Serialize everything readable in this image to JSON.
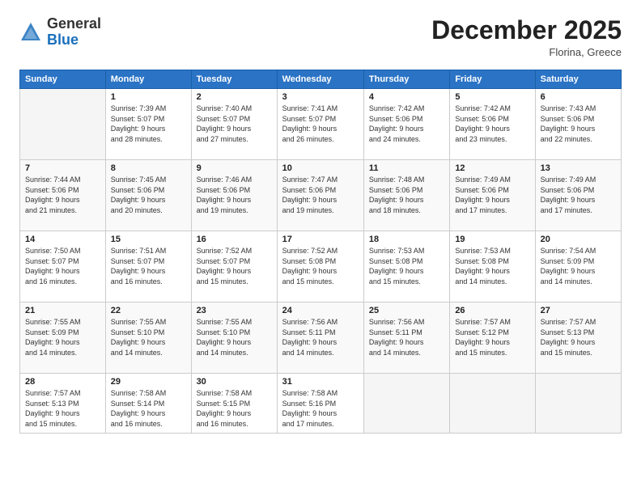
{
  "header": {
    "logo_general": "General",
    "logo_blue": "Blue",
    "month_year": "December 2025",
    "location": "Florina, Greece"
  },
  "days_of_week": [
    "Sunday",
    "Monday",
    "Tuesday",
    "Wednesday",
    "Thursday",
    "Friday",
    "Saturday"
  ],
  "weeks": [
    [
      {
        "num": "",
        "info": ""
      },
      {
        "num": "1",
        "info": "Sunrise: 7:39 AM\nSunset: 5:07 PM\nDaylight: 9 hours\nand 28 minutes."
      },
      {
        "num": "2",
        "info": "Sunrise: 7:40 AM\nSunset: 5:07 PM\nDaylight: 9 hours\nand 27 minutes."
      },
      {
        "num": "3",
        "info": "Sunrise: 7:41 AM\nSunset: 5:07 PM\nDaylight: 9 hours\nand 26 minutes."
      },
      {
        "num": "4",
        "info": "Sunrise: 7:42 AM\nSunset: 5:06 PM\nDaylight: 9 hours\nand 24 minutes."
      },
      {
        "num": "5",
        "info": "Sunrise: 7:42 AM\nSunset: 5:06 PM\nDaylight: 9 hours\nand 23 minutes."
      },
      {
        "num": "6",
        "info": "Sunrise: 7:43 AM\nSunset: 5:06 PM\nDaylight: 9 hours\nand 22 minutes."
      }
    ],
    [
      {
        "num": "7",
        "info": "Sunrise: 7:44 AM\nSunset: 5:06 PM\nDaylight: 9 hours\nand 21 minutes."
      },
      {
        "num": "8",
        "info": "Sunrise: 7:45 AM\nSunset: 5:06 PM\nDaylight: 9 hours\nand 20 minutes."
      },
      {
        "num": "9",
        "info": "Sunrise: 7:46 AM\nSunset: 5:06 PM\nDaylight: 9 hours\nand 19 minutes."
      },
      {
        "num": "10",
        "info": "Sunrise: 7:47 AM\nSunset: 5:06 PM\nDaylight: 9 hours\nand 19 minutes."
      },
      {
        "num": "11",
        "info": "Sunrise: 7:48 AM\nSunset: 5:06 PM\nDaylight: 9 hours\nand 18 minutes."
      },
      {
        "num": "12",
        "info": "Sunrise: 7:49 AM\nSunset: 5:06 PM\nDaylight: 9 hours\nand 17 minutes."
      },
      {
        "num": "13",
        "info": "Sunrise: 7:49 AM\nSunset: 5:06 PM\nDaylight: 9 hours\nand 17 minutes."
      }
    ],
    [
      {
        "num": "14",
        "info": "Sunrise: 7:50 AM\nSunset: 5:07 PM\nDaylight: 9 hours\nand 16 minutes."
      },
      {
        "num": "15",
        "info": "Sunrise: 7:51 AM\nSunset: 5:07 PM\nDaylight: 9 hours\nand 16 minutes."
      },
      {
        "num": "16",
        "info": "Sunrise: 7:52 AM\nSunset: 5:07 PM\nDaylight: 9 hours\nand 15 minutes."
      },
      {
        "num": "17",
        "info": "Sunrise: 7:52 AM\nSunset: 5:08 PM\nDaylight: 9 hours\nand 15 minutes."
      },
      {
        "num": "18",
        "info": "Sunrise: 7:53 AM\nSunset: 5:08 PM\nDaylight: 9 hours\nand 15 minutes."
      },
      {
        "num": "19",
        "info": "Sunrise: 7:53 AM\nSunset: 5:08 PM\nDaylight: 9 hours\nand 14 minutes."
      },
      {
        "num": "20",
        "info": "Sunrise: 7:54 AM\nSunset: 5:09 PM\nDaylight: 9 hours\nand 14 minutes."
      }
    ],
    [
      {
        "num": "21",
        "info": "Sunrise: 7:55 AM\nSunset: 5:09 PM\nDaylight: 9 hours\nand 14 minutes."
      },
      {
        "num": "22",
        "info": "Sunrise: 7:55 AM\nSunset: 5:10 PM\nDaylight: 9 hours\nand 14 minutes."
      },
      {
        "num": "23",
        "info": "Sunrise: 7:55 AM\nSunset: 5:10 PM\nDaylight: 9 hours\nand 14 minutes."
      },
      {
        "num": "24",
        "info": "Sunrise: 7:56 AM\nSunset: 5:11 PM\nDaylight: 9 hours\nand 14 minutes."
      },
      {
        "num": "25",
        "info": "Sunrise: 7:56 AM\nSunset: 5:11 PM\nDaylight: 9 hours\nand 14 minutes."
      },
      {
        "num": "26",
        "info": "Sunrise: 7:57 AM\nSunset: 5:12 PM\nDaylight: 9 hours\nand 15 minutes."
      },
      {
        "num": "27",
        "info": "Sunrise: 7:57 AM\nSunset: 5:13 PM\nDaylight: 9 hours\nand 15 minutes."
      }
    ],
    [
      {
        "num": "28",
        "info": "Sunrise: 7:57 AM\nSunset: 5:13 PM\nDaylight: 9 hours\nand 15 minutes."
      },
      {
        "num": "29",
        "info": "Sunrise: 7:58 AM\nSunset: 5:14 PM\nDaylight: 9 hours\nand 16 minutes."
      },
      {
        "num": "30",
        "info": "Sunrise: 7:58 AM\nSunset: 5:15 PM\nDaylight: 9 hours\nand 16 minutes."
      },
      {
        "num": "31",
        "info": "Sunrise: 7:58 AM\nSunset: 5:16 PM\nDaylight: 9 hours\nand 17 minutes."
      },
      {
        "num": "",
        "info": ""
      },
      {
        "num": "",
        "info": ""
      },
      {
        "num": "",
        "info": ""
      }
    ]
  ]
}
